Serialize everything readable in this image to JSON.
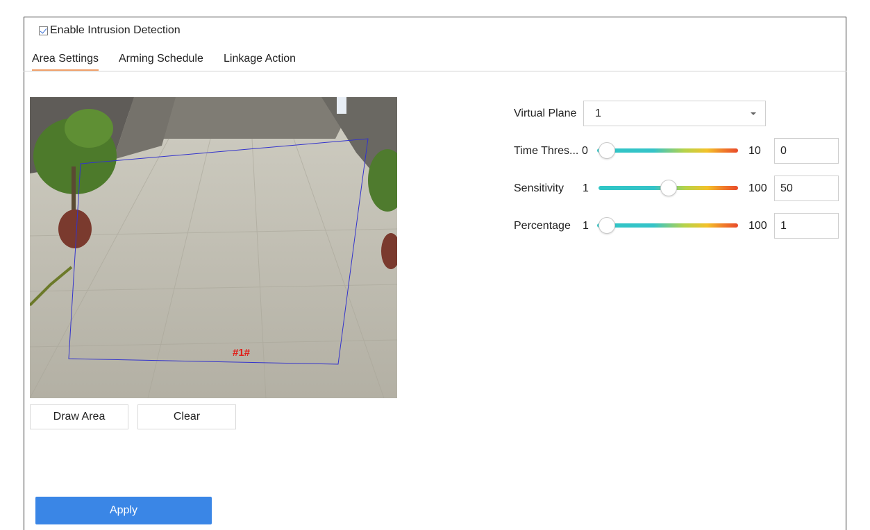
{
  "enable": {
    "label": "Enable Intrusion Detection",
    "checked": true
  },
  "tabs": [
    {
      "label": "Area Settings",
      "active": true
    },
    {
      "label": "Arming Schedule",
      "active": false
    },
    {
      "label": "Linkage Action",
      "active": false
    }
  ],
  "preview": {
    "zone_label": "#1#"
  },
  "buttons": {
    "draw_area": "Draw Area",
    "clear": "Clear",
    "apply": "Apply"
  },
  "virtual_plane": {
    "label": "Virtual Plane",
    "value": "1"
  },
  "sliders": [
    {
      "label": "Time Thres...",
      "min": "0",
      "max": "10",
      "value": "0",
      "fraction": 0
    },
    {
      "label": "Sensitivity",
      "min": "1",
      "max": "100",
      "value": "50",
      "fraction": 0.5
    },
    {
      "label": "Percentage",
      "min": "1",
      "max": "100",
      "value": "1",
      "fraction": 0
    }
  ],
  "colors": {
    "accent": "#3a86e6",
    "tab_underline": "#f1a06a",
    "zone_line": "#3333cc",
    "zone_label": "#e0201a"
  }
}
